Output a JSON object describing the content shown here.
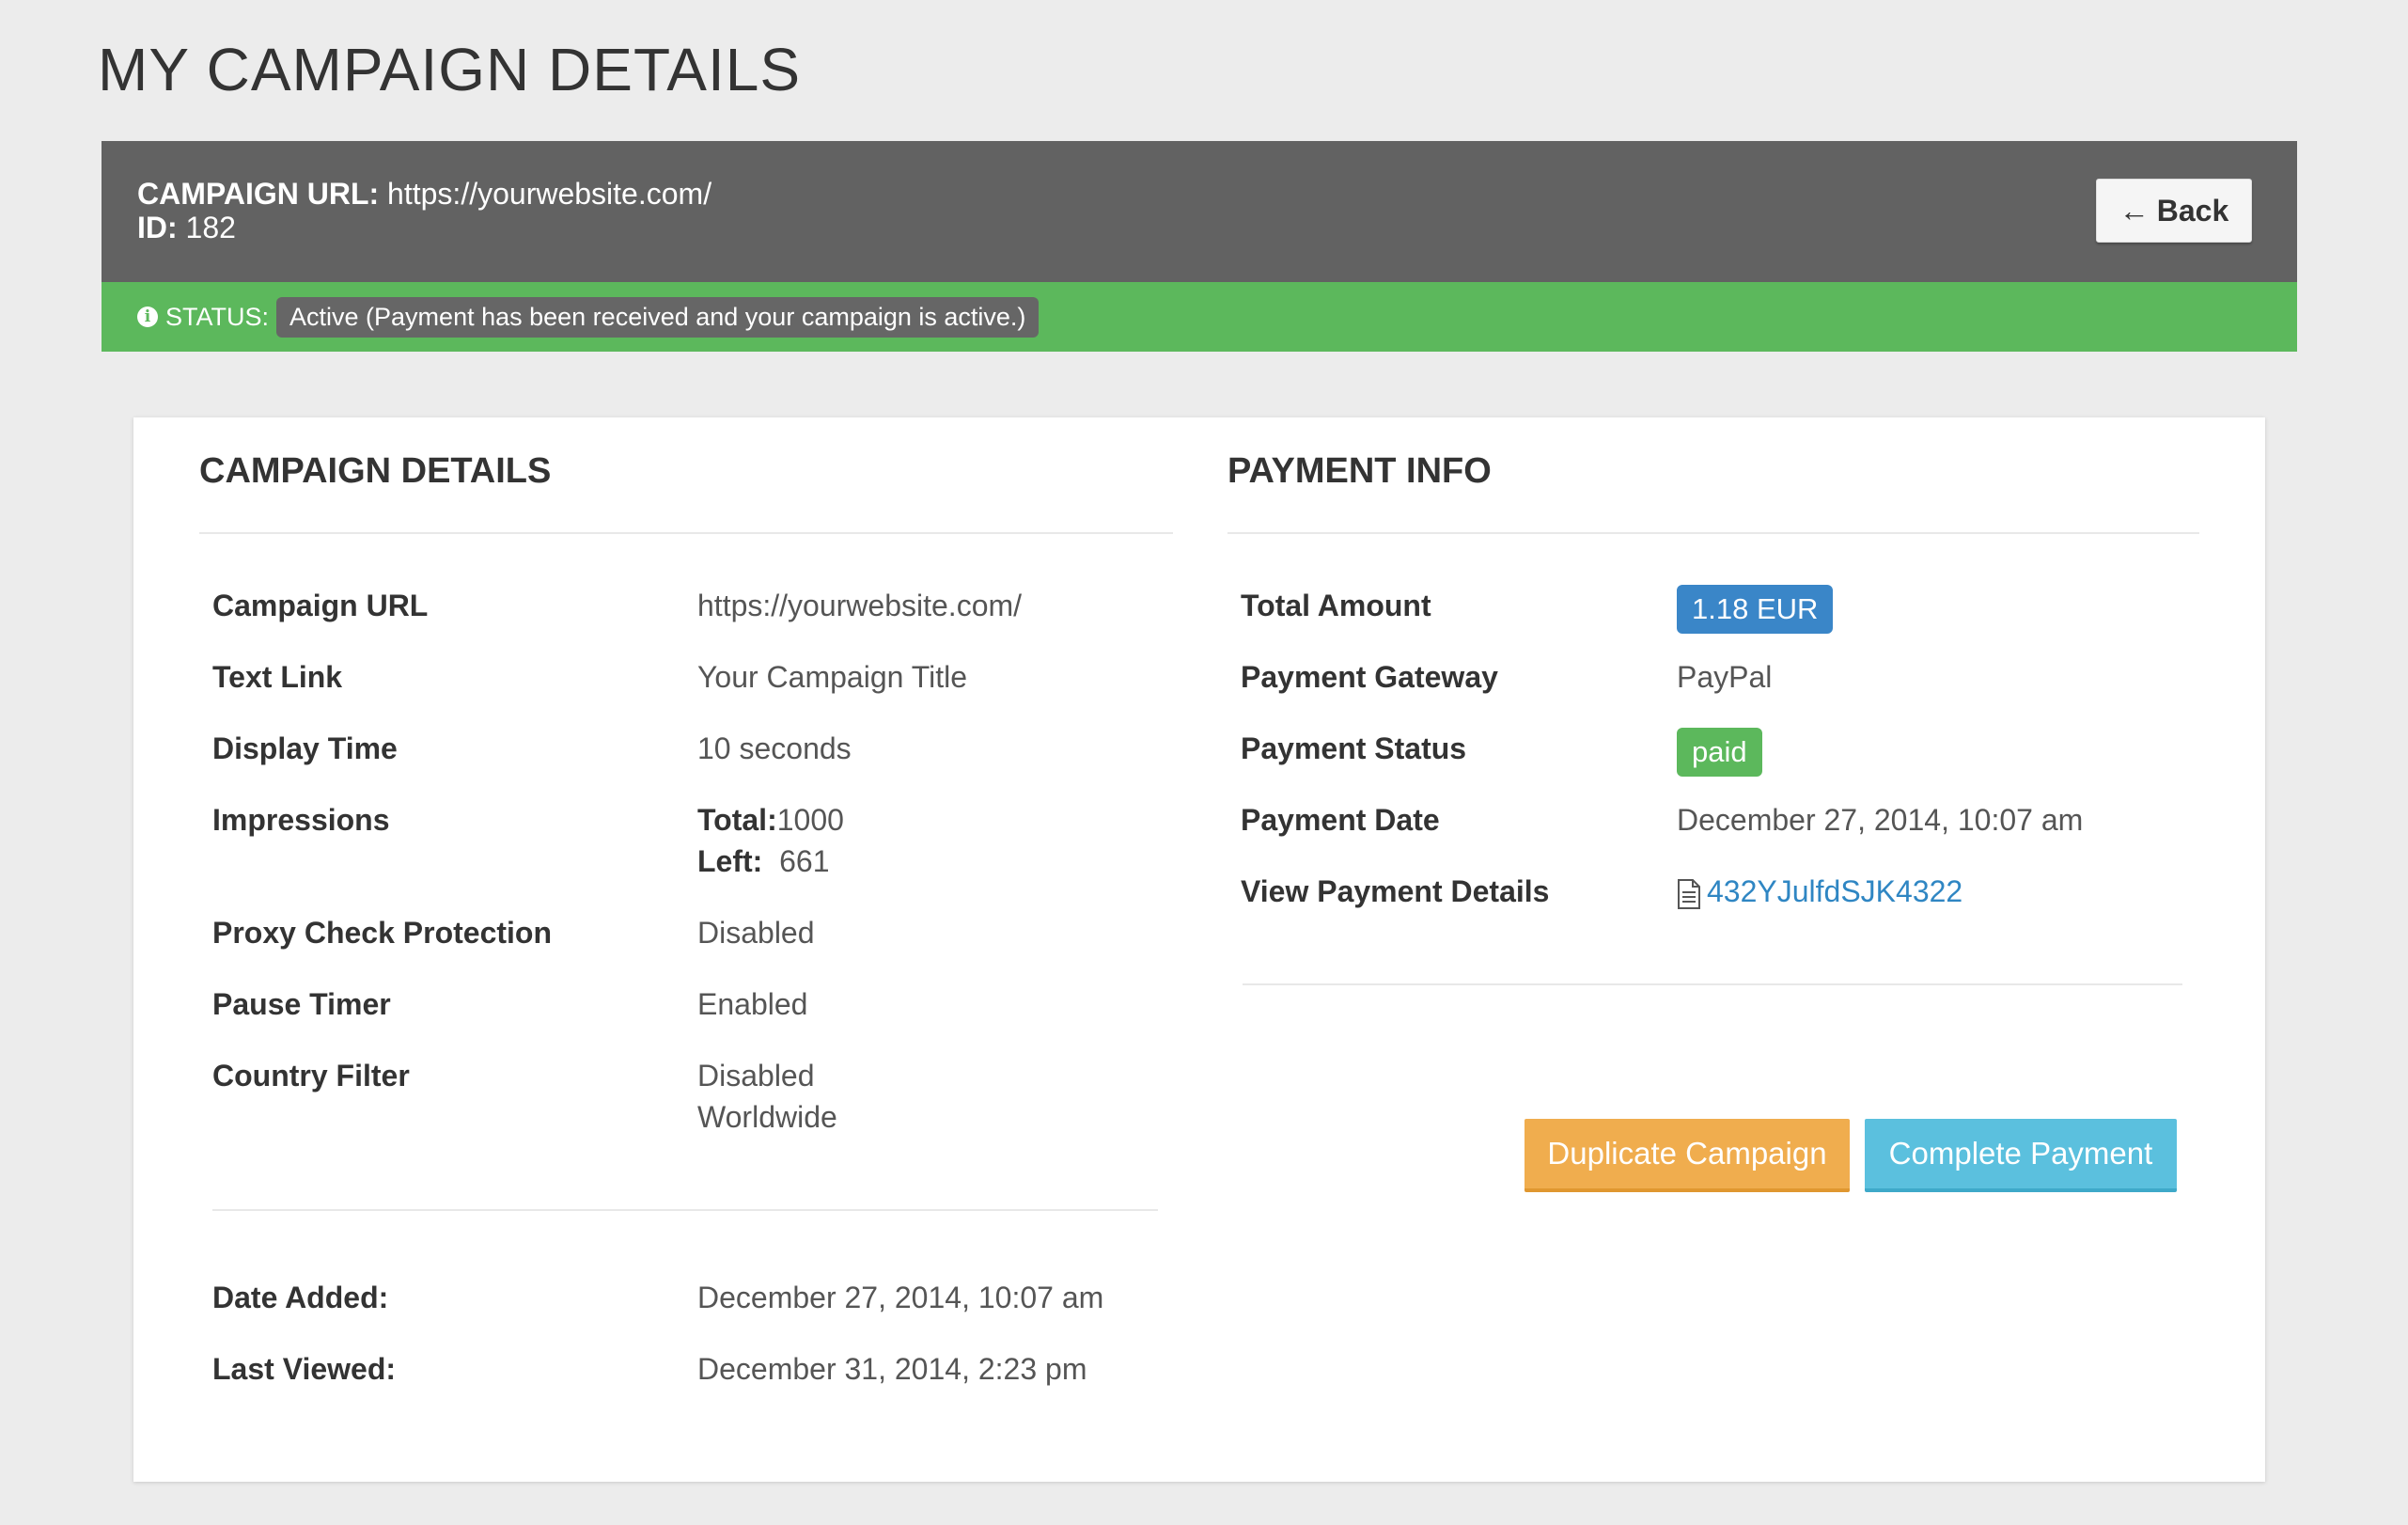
{
  "page": {
    "title": "MY CAMPAIGN DETAILS"
  },
  "header": {
    "url_label": "CAMPAIGN URL:",
    "url_value": "https://yourwebsite.com/",
    "id_label": "ID:",
    "id_value": "182",
    "back_label": "Back"
  },
  "status": {
    "label": "STATUS:",
    "text": "Active (Payment has been received and your campaign is active.)"
  },
  "campaign": {
    "title": "CAMPAIGN DETAILS",
    "rows": [
      {
        "label": "Campaign URL",
        "value": "https://yourwebsite.com/"
      },
      {
        "label": "Text Link",
        "value": "Your Campaign Title"
      },
      {
        "label": "Display Time",
        "value": "10 seconds"
      },
      {
        "label": "Impressions",
        "total_label": "Total:",
        "total_value": "1000",
        "left_label": "Left:",
        "left_value": "661"
      },
      {
        "label": "Proxy Check Protection",
        "value": "Disabled"
      },
      {
        "label": "Pause Timer",
        "value": "Enabled"
      },
      {
        "label": "Country Filter",
        "value": "Disabled",
        "value2": "Worldwide"
      }
    ],
    "date_added_label": "Date Added:",
    "date_added_value": "December 27, 2014, 10:07 am",
    "last_viewed_label": "Last Viewed:",
    "last_viewed_value": "December 31, 2014, 2:23 pm"
  },
  "payment": {
    "title": "PAYMENT INFO",
    "total_amount_label": "Total Amount",
    "total_amount_value": "1.18 EUR",
    "gateway_label": "Payment Gateway",
    "gateway_value": "PayPal",
    "status_label": "Payment Status",
    "status_value": "paid",
    "date_label": "Payment Date",
    "date_value": "December 27, 2014, 10:07 am",
    "details_label": "View Payment Details",
    "details_link": "432YJulfdSJK4322"
  },
  "actions": {
    "duplicate_label": "Duplicate Campaign",
    "complete_label": "Complete Payment"
  },
  "colors": {
    "header": "#626262",
    "status": "#5cb85c",
    "badge_blue": "#3a86c8",
    "orange": "#f0ad4e",
    "teal": "#5bc0de",
    "link": "#2f86c3"
  }
}
